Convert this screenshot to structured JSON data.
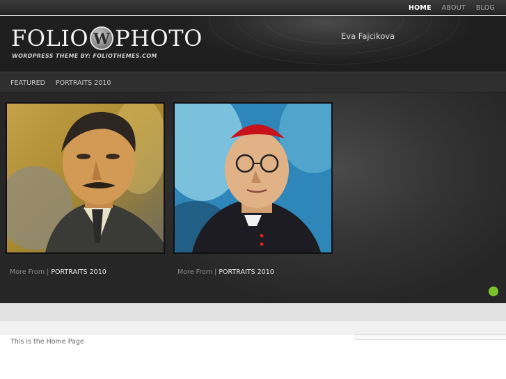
{
  "topnav": {
    "items": [
      {
        "label": "HOME",
        "active": true
      },
      {
        "label": "ABOUT"
      },
      {
        "label": "BLOG"
      }
    ]
  },
  "header": {
    "logo_left": "FOLIO",
    "logo_mark": "W",
    "logo_right": "PHOTO",
    "tagline": "WORDPRESS THEME BY: FOLIOTHEMES.COM",
    "owner": "Eva Fajcikova"
  },
  "categories": {
    "items": [
      "FEATURED",
      "PORTRAITS 2010"
    ]
  },
  "gallery": {
    "items": [
      {
        "more_label": "More From",
        "separator": "|",
        "category": "PORTRAITS 2010",
        "icon": "portrait-man-mustache"
      },
      {
        "more_label": "More From",
        "separator": "|",
        "category": "PORTRAITS 2010",
        "icon": "portrait-cardinal"
      }
    ]
  },
  "content": {
    "text": "This is the Home Page"
  },
  "colors": {
    "accent_green": "#7cc12c",
    "dark_bg": "#2b2b2b"
  }
}
